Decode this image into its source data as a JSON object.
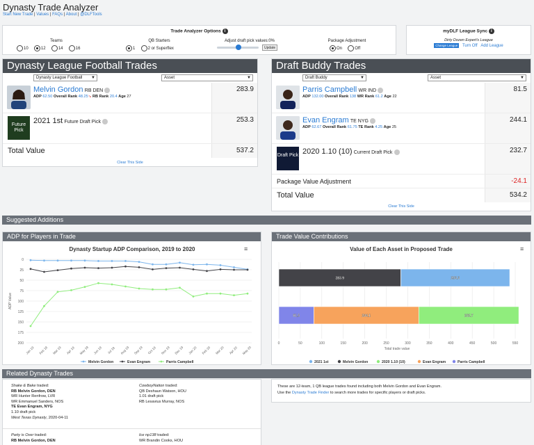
{
  "header": {
    "title": "Dynasty Trade Analyzer",
    "links": [
      "Start New Trade",
      "Values",
      "FAQs",
      "About",
      "@DLFTools"
    ]
  },
  "options": {
    "title": "Trade Analyzer Options",
    "teams_label": "Teams",
    "teams": [
      "10",
      "12",
      "14",
      "16"
    ],
    "teams_selected": "12",
    "qb_label": "QB Starters",
    "qb": [
      "1",
      "2 or Superflex"
    ],
    "qb_selected": "1",
    "draft_label": "Adjust draft pick values:",
    "draft_value": "0%",
    "update_label": "Update",
    "package_label": "Package Adjustment",
    "package": [
      "On",
      "Off"
    ],
    "package_selected": "On"
  },
  "sync": {
    "title": "myDLF League Sync",
    "league": "Dirty Dozen Expert's League",
    "change_label": "Change League",
    "turn_off": "Turn Off",
    "add_league": "Add League"
  },
  "left_side": {
    "title": "Dynasty League Football Trades",
    "team_select": "Dynasty League Football",
    "asset_select": "Asset",
    "players": [
      {
        "name": "Melvin Gordon",
        "pos": "RB DEN",
        "adp_label": "ADP",
        "adp": "62.50",
        "overall_label": "Overall Rank",
        "overall": "48.25",
        "pos_rank_label": "RB Rank",
        "pos_rank": "20.4",
        "age_label": "Age",
        "age": "27",
        "value": "283.9"
      }
    ],
    "picks": [
      {
        "label": "2021 1st",
        "sub": "Future Draft Pick",
        "img_text": "Future Pick",
        "value": "253.3"
      }
    ],
    "total_label": "Total Value",
    "total": "537.2",
    "clear": "Clear This Side"
  },
  "right_side": {
    "title": "Draft Buddy Trades",
    "team_select": "Draft Buddy",
    "asset_select": "Asset",
    "players": [
      {
        "name": "Parris Campbell",
        "pos": "WR IND",
        "adp_label": "ADP",
        "adp": "132.00",
        "overall_label": "Overall Rank",
        "overall": "138",
        "pos_rank_label": "WR Rank",
        "pos_rank": "61.2",
        "age_label": "Age",
        "age": "22",
        "value": "81.5"
      },
      {
        "name": "Evan Engram",
        "pos": "TE NYG",
        "adp_label": "ADP",
        "adp": "62.67",
        "overall_label": "Overall Rank",
        "overall": "61.75",
        "pos_rank_label": "TE Rank",
        "pos_rank": "4.25",
        "age_label": "Age",
        "age": "25",
        "value": "244.1"
      }
    ],
    "picks": [
      {
        "label": "2020 1.10 (10)",
        "sub": "Current Draft Pick",
        "img_text": "Draft Pick",
        "value": "232.7"
      }
    ],
    "package_label": "Package Value Adjustment",
    "package_value": "-24.1",
    "total_label": "Total Value",
    "total": "534.2",
    "clear": "Clear This Side"
  },
  "suggested": {
    "title": "Suggested Additions"
  },
  "adp_panel": {
    "header": "ADP for Players in Trade",
    "credit": "Highcharts.com"
  },
  "value_panel": {
    "header": "Trade Value Contributions",
    "credit": "Highcharts.com"
  },
  "chart_data": [
    {
      "type": "line",
      "title": "Dynasty Startup ADP Comparison, 2019 to 2020",
      "ylabel": "ADP Value",
      "xlabel": "",
      "ylim": [
        0,
        200
      ],
      "y_reversed": true,
      "yticks": [
        0,
        25,
        50,
        75,
        100,
        125,
        150,
        175,
        200
      ],
      "ytick_labels": [
        "0",
        "25",
        "50",
        "75",
        "100",
        "125",
        "150",
        "175",
        "200"
      ],
      "categories": [
        "Jan 19",
        "Feb 19",
        "Mar 19",
        "Apr 19",
        "May 19",
        "Jun 19",
        "Jul 19",
        "Aug 19",
        "Sep 19",
        "Oct 19",
        "Nov 19",
        "Dec 19",
        "Jan 20",
        "Feb 20",
        "Mar 20",
        "Apr 20",
        "May 20"
      ],
      "series": [
        {
          "name": "Melvin Gordon",
          "color": "#7cb5ec",
          "values": [
            2,
            3,
            3,
            3,
            3,
            4,
            4,
            4,
            6,
            12,
            12,
            8,
            13,
            12,
            14,
            19,
            24
          ]
        },
        {
          "name": "Evan Engram",
          "color": "#434348",
          "values": [
            23,
            30,
            26,
            22,
            20,
            21,
            20,
            17,
            19,
            24,
            21,
            20,
            24,
            28,
            24,
            25,
            25
          ]
        },
        {
          "name": "Parris Campbell",
          "color": "#90ed7d",
          "values": [
            160,
            112,
            78,
            74,
            66,
            57,
            60,
            65,
            70,
            72,
            72,
            68,
            89,
            82,
            82,
            86,
            82
          ]
        }
      ],
      "legend": "bottom",
      "grid": true
    },
    {
      "type": "bar",
      "stacked": true,
      "title": "Value of Each Asset in Proposed Trade",
      "xlabel": "Total trade value",
      "xlim": [
        0,
        550
      ],
      "xticks": [
        0,
        50,
        100,
        150,
        200,
        250,
        300,
        350,
        400,
        450,
        500,
        550
      ],
      "categories": [
        "Dynasty League Football",
        "Draft Buddy"
      ],
      "series": [
        {
          "name": "2021 1st",
          "color": "#7cb5ec",
          "values": [
            253.3,
            0
          ]
        },
        {
          "name": "Melvin Gordon",
          "color": "#434348",
          "values": [
            283.9,
            0
          ]
        },
        {
          "name": "2020 1.10 (10)",
          "color": "#90ed7d",
          "values": [
            0,
            232.7
          ]
        },
        {
          "name": "Evan Engram",
          "color": "#f7a35c",
          "values": [
            0,
            244.1
          ]
        },
        {
          "name": "Parris Campbell",
          "color": "#8085e9",
          "values": [
            0,
            81.5
          ]
        }
      ],
      "legend": "bottom",
      "grid": true
    }
  ],
  "related": {
    "title": "Related Dynasty Trades",
    "trades": [
      {
        "a_name": "Shake & Bake",
        "a_lines": [
          "RB Melvin Gordon, DEN",
          "WR Hunter Renfrow, LVR",
          "WR Emmanuel Sanders, NOS",
          "TE Evan Engram, NYG",
          "1.10 draft pick"
        ],
        "b_name": "CowboyNation",
        "b_lines": [
          "QB Deshaun Watson, HOU",
          "1.01 draft pick",
          "RB Lesavius Murray, NOS"
        ],
        "league": "West Texas Dynasty",
        "date": "2020-04-11"
      },
      {
        "a_name": "Party is Over",
        "a_lines": [
          "RB Melvin Gordon, DEN"
        ],
        "b_name": "Ice np138",
        "b_lines": [
          "WR Brandin Cooks, HOU"
        ],
        "league": "",
        "date": ""
      }
    ],
    "traded_word": "traded:",
    "info_line1": "These are 12-team, 1 QB league trades found including both Melvin Gordon and Evan Engram.",
    "info_line2_pre": "Use the",
    "info_link": "Dynasty Trade Finder",
    "info_line2_post": "to search more trades for specific players or draft picks."
  }
}
